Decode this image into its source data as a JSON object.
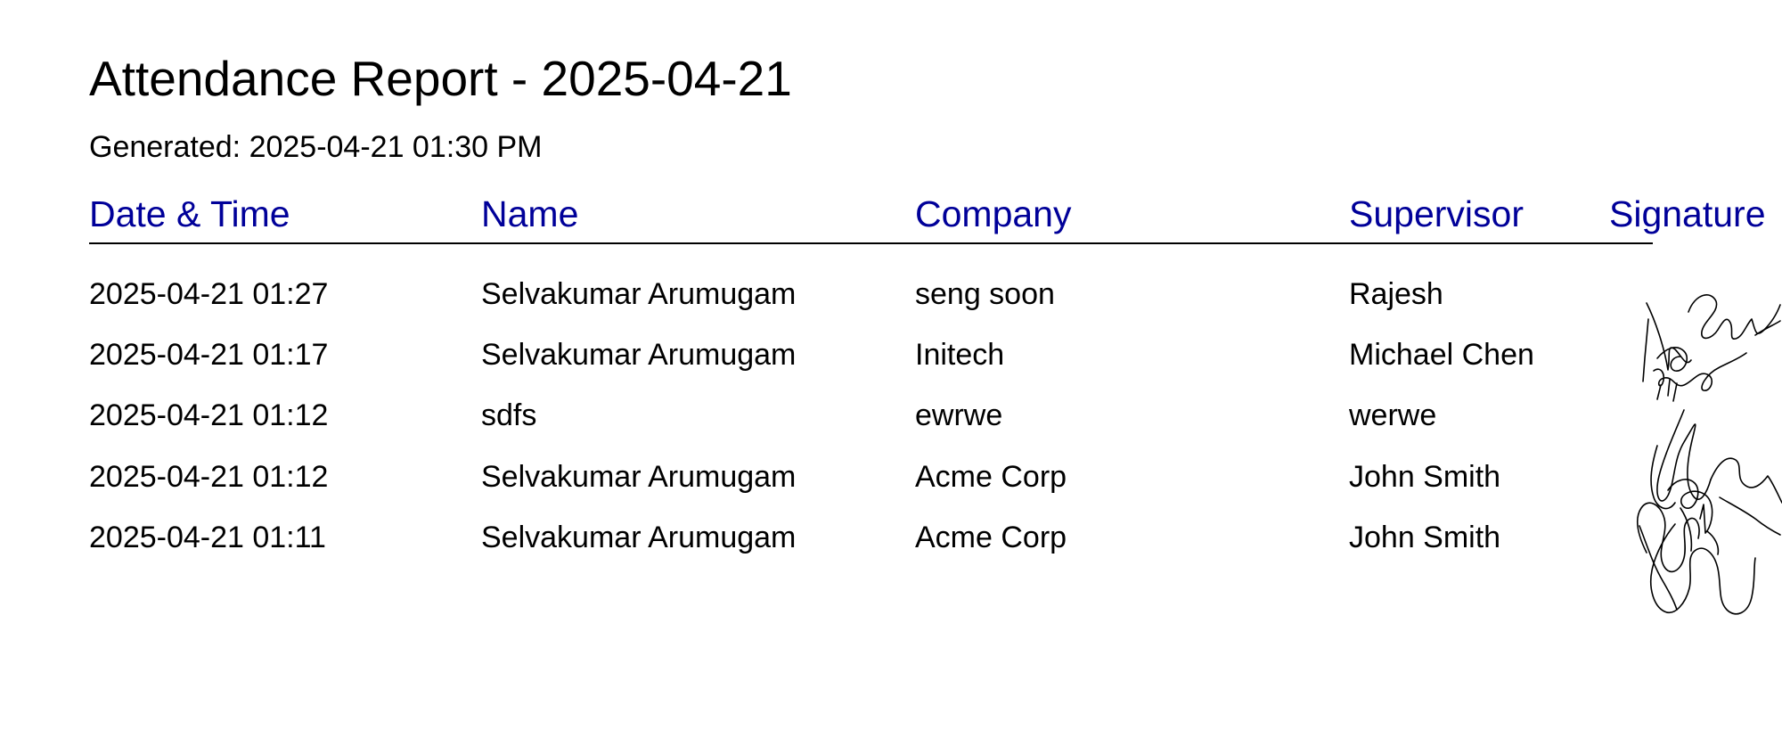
{
  "report": {
    "title": "Attendance Report - 2025-04-21",
    "generated": "Generated: 2025-04-21 01:30 PM"
  },
  "table": {
    "headers": [
      "Date & Time",
      "Name",
      "Company",
      "Supervisor",
      "Signature"
    ],
    "header_color": "#000099",
    "rows": [
      [
        "2025-04-21 01:27",
        "Selvakumar Arumugam",
        "seng soon",
        "Rajesh"
      ],
      [
        "2025-04-21 01:17",
        "Selvakumar Arumugam",
        "Initech",
        "Michael Chen"
      ],
      [
        "2025-04-21 01:12",
        "sdfs",
        "ewrwe",
        "werwe"
      ],
      [
        "2025-04-21 01:12",
        "Selvakumar Arumugam",
        "Acme Corp",
        "John Smith"
      ],
      [
        "2025-04-21 01:11",
        "Selvakumar Arumugam",
        "Acme Corp",
        "John Smith"
      ]
    ]
  },
  "signature_image": "handwritten-signatures-scribble"
}
